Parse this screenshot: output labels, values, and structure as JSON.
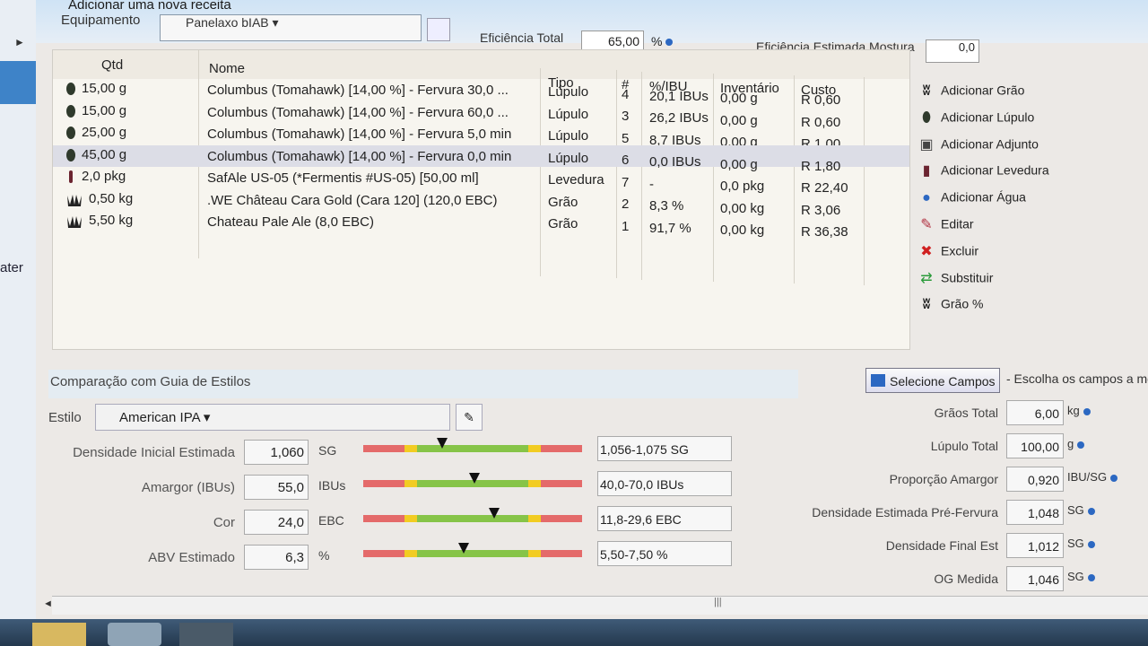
{
  "window": {
    "title": "Adicionar uma nova receita",
    "equipment_label": "Equipamento",
    "equipment_value": "Panelaxo bIAB",
    "efficiency_label": "Eficiência Total",
    "efficiency_value": "65,00",
    "efficiency_unit": "%",
    "mash_eff_label": "Eficiência Estimada Mostura",
    "mash_eff_value": "0,0"
  },
  "left_strip": {
    "partial_label": "ater"
  },
  "table": {
    "headers": {
      "qtd": "Qtd",
      "nome": "Nome",
      "tipo": "Tipo",
      "num": "#",
      "ibu": "%/IBU",
      "inventario": "Inventário",
      "custo": "Custo"
    },
    "rows": [
      {
        "icon": "hop-icon",
        "qtd": "15,00 g",
        "nome": "Columbus (Tomahawk) [14,00 %] - Fervura 30,0 ...",
        "tipo": "Lúpulo",
        "num": "4",
        "ibu": "20,1 IBUs",
        "inventario": "0,00 g",
        "custo": "R 0,60"
      },
      {
        "icon": "hop-icon",
        "qtd": "15,00 g",
        "nome": "Columbus (Tomahawk) [14,00 %] - Fervura 60,0 ...",
        "tipo": "Lúpulo",
        "num": "3",
        "ibu": "26,2 IBUs",
        "inventario": "0,00 g",
        "custo": "R 0,60"
      },
      {
        "icon": "hop-icon",
        "qtd": "25,00 g",
        "nome": "Columbus (Tomahawk) [14,00 %] - Fervura 5,0 min",
        "tipo": "Lúpulo",
        "num": "5",
        "ibu": "8,7 IBUs",
        "inventario": "0,00 g",
        "custo": "R 1,00"
      },
      {
        "icon": "hop-icon",
        "qtd": "45,00 g",
        "nome": "Columbus (Tomahawk) [14,00 %] - Fervura 0,0 min",
        "tipo": "Lúpulo",
        "num": "6",
        "ibu": "0,0 IBUs",
        "inventario": "0,00 g",
        "custo": "R 1,80"
      },
      {
        "icon": "yeast-icon",
        "qtd": "2,0 pkg",
        "nome": "SafAle US-05 (*Fermentis #US-05) [50,00 ml]",
        "tipo": "Levedura",
        "num": "7",
        "ibu": "-",
        "inventario": "0,0 pkg",
        "custo": "R 22,40"
      },
      {
        "icon": "grain-icon",
        "qtd": "0,50 kg",
        "nome": ".WE Château Cara Gold (Cara 120] (120,0 EBC)",
        "tipo": "Grão",
        "num": "2",
        "ibu": "8,3 %",
        "inventario": "0,00 kg",
        "custo": "R 3,06"
      },
      {
        "icon": "grain-icon",
        "qtd": "5,50 kg",
        "nome": "Chateau Pale Ale (8,0 EBC)",
        "tipo": "Grão",
        "num": "1",
        "ibu": "91,7 %",
        "inventario": "0,00 kg",
        "custo": "R 36,38"
      }
    ]
  },
  "actions": [
    {
      "label": "Adicionar Grão",
      "icon": "grain-icon"
    },
    {
      "label": "Adicionar Lúpulo",
      "icon": "hop-icon"
    },
    {
      "label": "Adicionar Adjunto",
      "icon": "adjunct-icon"
    },
    {
      "label": "Adicionar Levedura",
      "icon": "yeast-icon"
    },
    {
      "label": "Adicionar Água",
      "icon": "water-drop-icon"
    },
    {
      "label": "Editar",
      "icon": "edit-icon"
    },
    {
      "label": "Excluir",
      "icon": "delete-x-icon"
    },
    {
      "label": "Substituir",
      "icon": "replace-arrows-icon"
    },
    {
      "label": "Grão %",
      "icon": "grain-icon"
    }
  ],
  "style_guide": {
    "title": "Comparação com Guia de Estilos",
    "estilo_label": "Estilo",
    "estilo_value": "American IPA",
    "metrics": [
      {
        "label": "Densidade Inicial Estimada",
        "value": "1,060",
        "unit": "SG",
        "range": "1,056-1,075 SG",
        "marker_pct": 0.36
      },
      {
        "label": "Amargor (IBUs)",
        "value": "55,0",
        "unit": "IBUs",
        "range": "40,0-70,0 IBUs",
        "marker_pct": 0.51
      },
      {
        "label": "Cor",
        "value": "24,0",
        "unit": "EBC",
        "range": "11,8-29,6 EBC",
        "marker_pct": 0.6
      },
      {
        "label": "ABV Estimado",
        "value": "6,3",
        "unit": "%",
        "range": "5,50-7,50 %",
        "marker_pct": 0.46
      }
    ]
  },
  "select_fields": {
    "button_label": "Selecione Campos",
    "hint": "- Escolha os campos a mo"
  },
  "right_stats": [
    {
      "label": "Grãos Total",
      "value": "6,00",
      "unit": "kg"
    },
    {
      "label": "Lúpulo Total",
      "value": "100,00",
      "unit": "g"
    },
    {
      "label": "Proporção Amargor",
      "value": "0,920",
      "unit": "IBU/SG"
    },
    {
      "label": "Densidade Estimada Pré-Fervura",
      "value": "1,048",
      "unit": "SG"
    },
    {
      "label": "Densidade Final Est",
      "value": "1,012",
      "unit": "SG"
    },
    {
      "label": "OG Medida",
      "value": "1,046",
      "unit": "SG"
    }
  ],
  "colors": {
    "accent": "#2c68c2",
    "bar_red": "#e46a6a",
    "bar_yellow": "#f2cc22",
    "bar_green": "#86c448"
  }
}
